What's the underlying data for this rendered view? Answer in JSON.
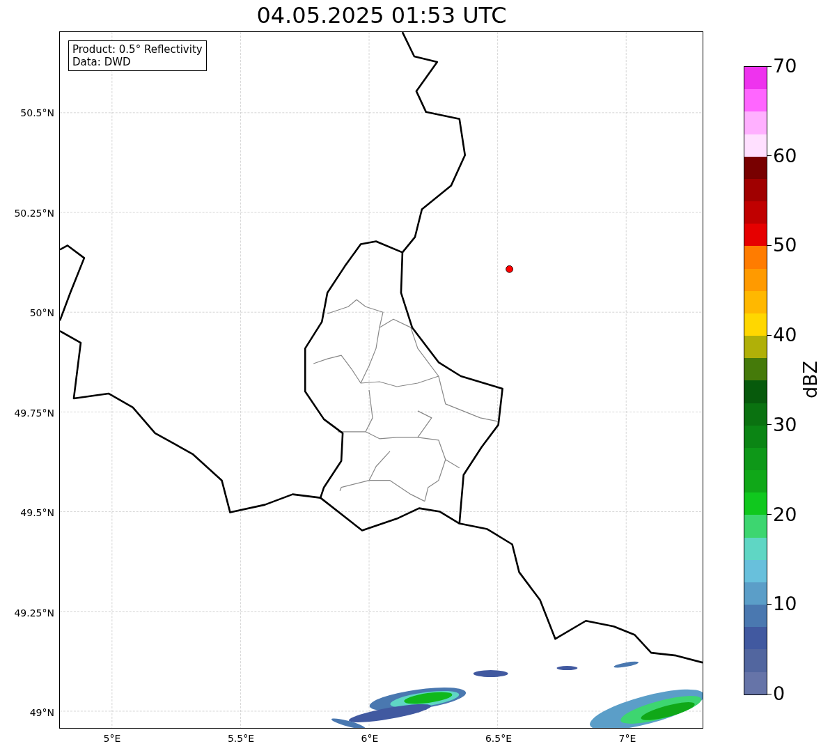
{
  "title": "04.05.2025 01:53 UTC",
  "info_box": {
    "lines": [
      "Product: 0.5° Reflectivity",
      "Data: DWD"
    ]
  },
  "map": {
    "lat_ticks": [
      "50.5°N",
      "50.25°N",
      "50°N",
      "49.75°N",
      "49.5°N",
      "49.25°N",
      "49°N"
    ],
    "lon_ticks": [
      "5°E",
      "5.5°E",
      "6°E",
      "6.5°E",
      "7°E"
    ]
  },
  "colorbar": {
    "label": "dBZ",
    "ticks": [
      "70",
      "60",
      "50",
      "40",
      "30",
      "20",
      "10",
      "0"
    ],
    "bands": [
      {
        "color": "#ee33ee"
      },
      {
        "color": "#ff66ff"
      },
      {
        "color": "#ffb0ff"
      },
      {
        "color": "#ffe0ff"
      },
      {
        "color": "#780000"
      },
      {
        "color": "#a00000"
      },
      {
        "color": "#c00000"
      },
      {
        "color": "#e60000"
      },
      {
        "color": "#ff7c00"
      },
      {
        "color": "#ff9a00"
      },
      {
        "color": "#ffb800"
      },
      {
        "color": "#ffd700"
      },
      {
        "color": "#b0b008"
      },
      {
        "color": "#457a0a"
      },
      {
        "color": "#075a0c"
      },
      {
        "color": "#0a7210"
      },
      {
        "color": "#0b8514"
      },
      {
        "color": "#0e9818"
      },
      {
        "color": "#10a818"
      },
      {
        "color": "#10c81e"
      },
      {
        "color": "#3dd670"
      },
      {
        "color": "#5fd6c4"
      },
      {
        "color": "#68c0dc"
      },
      {
        "color": "#5b9ec8"
      },
      {
        "color": "#4a78b0"
      },
      {
        "color": "#4159a0"
      },
      {
        "color": "#52669f"
      },
      {
        "color": "#6674a8"
      }
    ]
  }
}
